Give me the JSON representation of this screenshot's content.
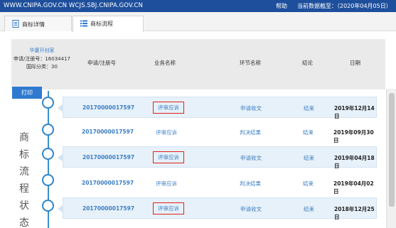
{
  "topbar": {
    "url": "WWW.CNIPA.GOV.CN WCJS.SBJ.CNIPA.GOV.CN",
    "help": "帮助",
    "as_of": "当前数据截至：（2020年04月05日）"
  },
  "tabs": [
    {
      "label": "商标详情",
      "icon": "document-icon",
      "active": false
    },
    {
      "label": "商标流程",
      "icon": "list-icon",
      "active": true
    }
  ],
  "info": {
    "applicant": "华厦开创家",
    "reg_label": "申请/注册号：16034417",
    "class_label": "国际分类：30"
  },
  "headers": {
    "regno": "申请/注册号",
    "biz": "业务名称",
    "step": "环节名称",
    "conclusion": "结论",
    "date": "日期"
  },
  "print_label": "打印",
  "vertical_label": [
    "商",
    "标",
    "流",
    "程",
    "状",
    "态"
  ],
  "rows": [
    {
      "regno": "20170000017597",
      "biz": "评审应诉",
      "step": "申请收文",
      "conclusion": "结束",
      "date": "2019年12月14日",
      "highlight": true
    },
    {
      "regno": "20170000017597",
      "biz": "评审应诉",
      "step": "判决结果",
      "conclusion": "结束",
      "date": "2019年09月30日",
      "highlight": false
    },
    {
      "regno": "20170000017597",
      "biz": "评审应诉",
      "step": "申请收文",
      "conclusion": "结束",
      "date": "2019年04月18日",
      "highlight": true
    },
    {
      "regno": "20170000017597",
      "biz": "评审应诉",
      "step": "判决结果",
      "conclusion": "结束",
      "date": "2019年04月02日",
      "highlight": false
    },
    {
      "regno": "20170000017597",
      "biz": "评审应诉",
      "step": "申请收文",
      "conclusion": "结束",
      "date": "2018年12月25日",
      "highlight": true
    }
  ],
  "colors": {
    "topbar": "#1e4f9c",
    "accent": "#2f84cc",
    "highlight_box": "#e02020"
  }
}
